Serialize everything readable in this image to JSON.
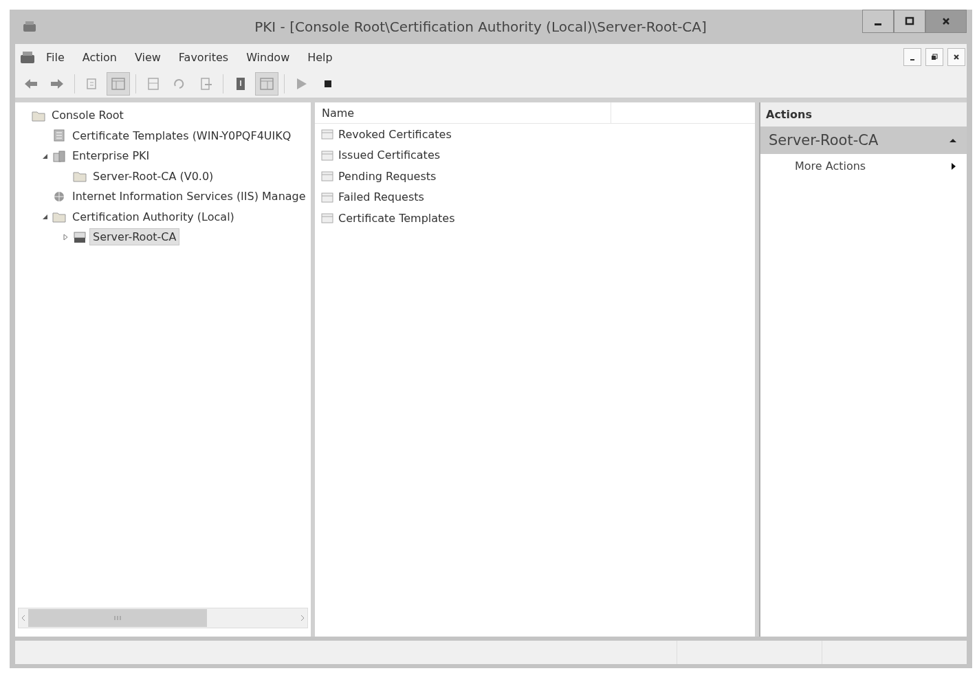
{
  "window": {
    "title": "PKI - [Console Root\\Certification Authority (Local)\\Server-Root-CA]"
  },
  "menu": [
    "File",
    "Action",
    "View",
    "Favorites",
    "Window",
    "Help"
  ],
  "toolbar": [
    {
      "kind": "back",
      "pressed": false
    },
    {
      "kind": "forward",
      "pressed": false
    },
    {
      "kind": "sep"
    },
    {
      "kind": "up",
      "pressed": false
    },
    {
      "kind": "tree",
      "pressed": true
    },
    {
      "kind": "sep"
    },
    {
      "kind": "props",
      "pressed": false
    },
    {
      "kind": "refresh",
      "pressed": false
    },
    {
      "kind": "export",
      "pressed": false
    },
    {
      "kind": "sep"
    },
    {
      "kind": "help",
      "pressed": false
    },
    {
      "kind": "pane",
      "pressed": true
    },
    {
      "kind": "sep"
    },
    {
      "kind": "play",
      "pressed": false
    },
    {
      "kind": "stop",
      "pressed": false
    }
  ],
  "tree": [
    {
      "label": "Console Root",
      "kind": "folder",
      "selected": false,
      "children": [
        {
          "label": "Certificate Templates (WIN-Y0PQF4UIKQ",
          "kind": "doc",
          "selected": false
        },
        {
          "label": "Enterprise PKI",
          "kind": "pki",
          "expanded": true,
          "selected": false,
          "children": [
            {
              "label": "Server-Root-CA (V0.0)",
              "kind": "folder",
              "selected": false
            }
          ]
        },
        {
          "label": "Internet Information Services (IIS) Manage",
          "kind": "globe",
          "selected": false
        },
        {
          "label": "Certification Authority (Local)",
          "kind": "folder",
          "expanded": true,
          "selected": false,
          "children": [
            {
              "label": "Server-Root-CA",
              "kind": "server",
              "expanded": false,
              "selected": true
            }
          ]
        }
      ]
    }
  ],
  "list": {
    "columns": [
      "Name"
    ],
    "rows": [
      "Revoked Certificates",
      "Issued Certificates",
      "Pending Requests",
      "Failed Requests",
      "Certificate Templates"
    ]
  },
  "actions": {
    "title": "Actions",
    "sections": [
      {
        "label": "Server-Root-CA",
        "expanded": true,
        "items": [
          {
            "label": "More Actions",
            "submenu": true
          }
        ]
      }
    ]
  }
}
